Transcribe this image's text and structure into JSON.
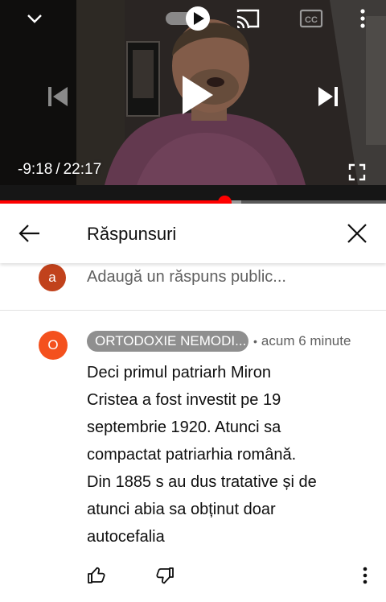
{
  "player": {
    "time_remaining": "-9:18",
    "separator": "/",
    "duration": "22:17",
    "progress_fraction": 0.582,
    "buffered_fraction": 0.625,
    "autoplay": "on",
    "colors": {
      "progress_played": "#ff0000",
      "progress_buffered": "#9a9a9a"
    },
    "icons": [
      "chevron-down-icon",
      "autoplay-toggle-icon",
      "cast-icon",
      "captions-icon",
      "more-vertical-icon",
      "previous-icon",
      "play-icon",
      "next-icon",
      "fullscreen-icon"
    ]
  },
  "header": {
    "title": "Răspunsuri",
    "icons": [
      "back-arrow-icon",
      "close-icon"
    ]
  },
  "add_reply": {
    "avatar_letter": "a",
    "avatar_color": "#c1421c",
    "placeholder": "Adaugă un răspuns public..."
  },
  "comment": {
    "avatar_letter": "O",
    "avatar_color": "#f4511e",
    "author": "ORTODOXIE NEMODI...",
    "bullet": "•",
    "time_ago": "acum 6 minute",
    "text": "Deci primul patriarh Miron\nCristea a fost investit pe 19\nseptembrie 1920. Atunci sa\ncompactat patriarhia română.\nDin 1885 s au dus tratative și de\natunci abia sa obținut doar\nautocefalia",
    "icons": [
      "like-icon",
      "dislike-icon",
      "more-vertical-icon"
    ]
  }
}
